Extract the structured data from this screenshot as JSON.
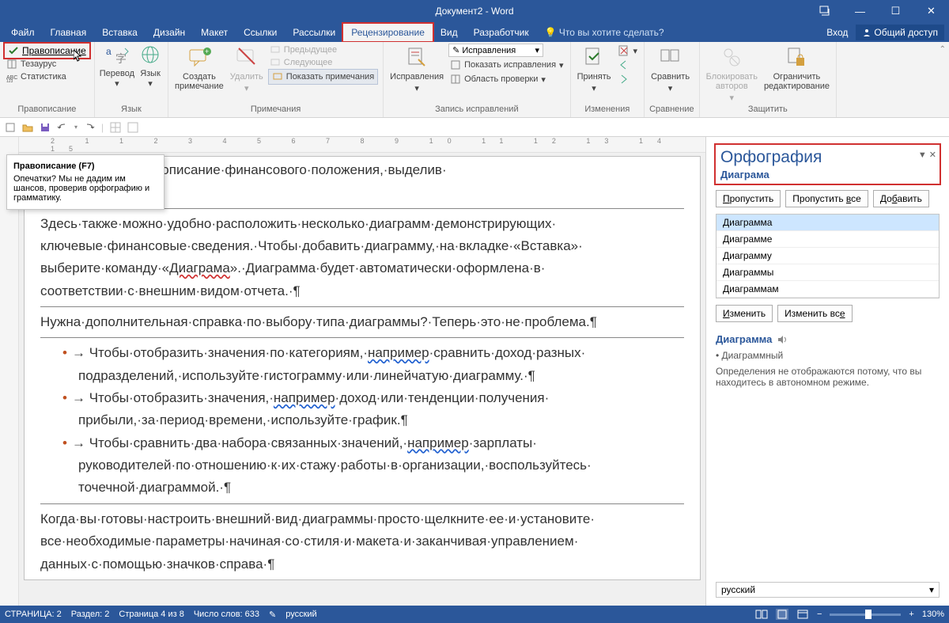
{
  "titlebar": {
    "title": "Документ2 - Word"
  },
  "menu": {
    "file": "Файл",
    "home": "Главная",
    "insert": "Вставка",
    "design": "Дизайн",
    "layout": "Макет",
    "refs": "Ссылки",
    "mail": "Рассылки",
    "review": "Рецензирование",
    "view": "Вид",
    "dev": "Разработчик",
    "tellme": "Что вы хотите сделать?",
    "signin": "Вход",
    "share": "Общий доступ"
  },
  "ribbon": {
    "spelling": "Правописание",
    "thesaurus": "Тезаурус",
    "stats": "Статистика",
    "group_spelling": "Правописание",
    "translate": "Перевод",
    "language": "Язык",
    "group_lang": "Язык",
    "new_comment": "Создать\nпримечание",
    "delete_comment": "Удалить",
    "prev": "Предыдущее",
    "next": "Следующее",
    "show_comments": "Показать примечания",
    "group_comments": "Примечания",
    "track": "Исправления",
    "track_combo": "Исправления",
    "show_markup": "Показать исправления",
    "review_pane": "Область проверки",
    "group_track": "Запись исправлений",
    "accept": "Принять",
    "reject_icon": "reject",
    "group_changes": "Изменения",
    "compare": "Сравнить",
    "group_compare": "Сравнение",
    "block_authors": "Блокировать\nавторов",
    "restrict": "Ограничить\nредактирование",
    "group_protect": "Защитить"
  },
  "tooltip": {
    "title": "Правописание (F7)",
    "body": "Опечатки? Мы не дадим им шансов, проверив орфографию и грамматику."
  },
  "doc": {
    "l1": "м·разделе·краткое·описание·финансового·положения,·выделив·",
    "l2a": "Здесь·также·можно·удобно·расположить·несколько·диаграмм·демонстрирующих·",
    "l2b": "ключевые·финансовые·сведения.·Чтобы·добавить·диаграмму,·на·вкладке·«Вставка»·",
    "l2c_pre": "выберите·команду·«",
    "l2c_err": "Диаграма",
    "l2c_post": "».·Диаграмма·будет·автоматически·оформлена·в·",
    "l2d": "соответствии·с·внешним·видом·отчета.·¶",
    "l3": "Нужна·дополнительная·справка·по·выбору·типа·диаграммы?·Теперь·это·не·проблема.¶",
    "li1a": "Чтобы·отобразить·значения·по·категориям,·",
    "li1ex": "например",
    "li1b": "·сравнить·доход·разных·",
    "li1c": "подразделений,·используйте·гистограмму·или·линейчатую·диаграмму.·¶",
    "li2a": "Чтобы·отобразить·значения,·",
    "li2ex": "например",
    "li2b": "·доход·или·тенденции·получения·",
    "li2c": "прибыли,·за·период·времени,·используйте·график.¶",
    "li3a": "Чтобы·сравнить·два·набора·связанных·значений,·",
    "li3ex": "например",
    "li3b": "·зарплаты·",
    "li3c": "руководителей·по·отношению·к·их·стажу·работы·в·организации,·воспользуйтесь·",
    "li3d": "точечной·диаграммой.·¶",
    "l4a": "Когда·вы·готовы·настроить·внешний·вид·диаграммы·просто·щелкните·ее·и·установите·",
    "l4b": "все·необходимые·параметры·начиная·со·стиля·и·макета·и·заканчивая·управлением·",
    "l4c": "данных·с·помощью·значков·справа·¶"
  },
  "pane": {
    "title": "Орфография",
    "word": "Диаграма",
    "skip": "Пропустить",
    "skip_all": "Пропустить все",
    "add": "Добавить",
    "sugg": [
      "Диаграмма",
      "Диаграмме",
      "Диаграмму",
      "Диаграммы",
      "Диаграммам"
    ],
    "change": "Изменить",
    "change_all": "Изменить все",
    "def_head": "Диаграмма",
    "def_bullet": "• Диаграммный",
    "def_note": "Определения не отображаются потому, что вы находитесь в автономном режиме.",
    "lang": "русский"
  },
  "status": {
    "page": "СТРАНИЦА: 2",
    "section": "Раздел: 2",
    "pageof": "Страница 4 из 8",
    "words": "Число слов: 633",
    "lang": "русский",
    "zoom": "130%"
  },
  "ruler": "2  1  1  2  3  4  5  6  7  8  9  10 11 12 13 14 15"
}
